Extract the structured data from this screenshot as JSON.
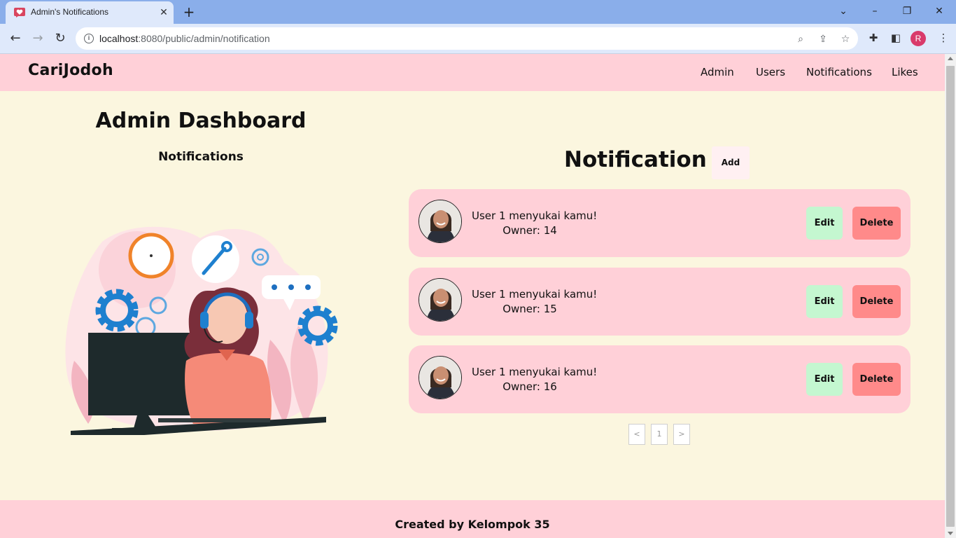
{
  "browser": {
    "tab_title": "Admin's Notifications",
    "url_host": "localhost",
    "url_path": ":8080/public/admin/notification",
    "profile_initial": "R"
  },
  "navbar": {
    "brand": "CariJodoh",
    "links": [
      "Admin",
      "Users",
      "Notifications",
      "Likes"
    ]
  },
  "sidebar": {
    "title": "Admin Dashboard",
    "subtitle": "Notifications",
    "illustration": "customer-support-illustration"
  },
  "main": {
    "heading": "Notification",
    "add_label": "Add",
    "notifications": [
      {
        "message": "User 1 menyukai kamu!",
        "owner": "Owner: 14",
        "edit_label": "Edit",
        "delete_label": "Delete"
      },
      {
        "message": "User 1 menyukai kamu!",
        "owner": "Owner: 15",
        "edit_label": "Edit",
        "delete_label": "Delete"
      },
      {
        "message": "User 1 menyukai kamu!",
        "owner": "Owner: 16",
        "edit_label": "Edit",
        "delete_label": "Delete"
      }
    ],
    "pagination": {
      "prev": "<",
      "page": "1",
      "next": ">"
    }
  },
  "footer": {
    "text": "Created by Kelompok 35"
  },
  "colors": {
    "navbar_bg": "#ffd0d8",
    "page_bg": "#fbf6df",
    "edit_bg": "#c4f7d0",
    "delete_bg": "#ff8a8a",
    "chrome_tabstrip": "#8aaeea"
  }
}
